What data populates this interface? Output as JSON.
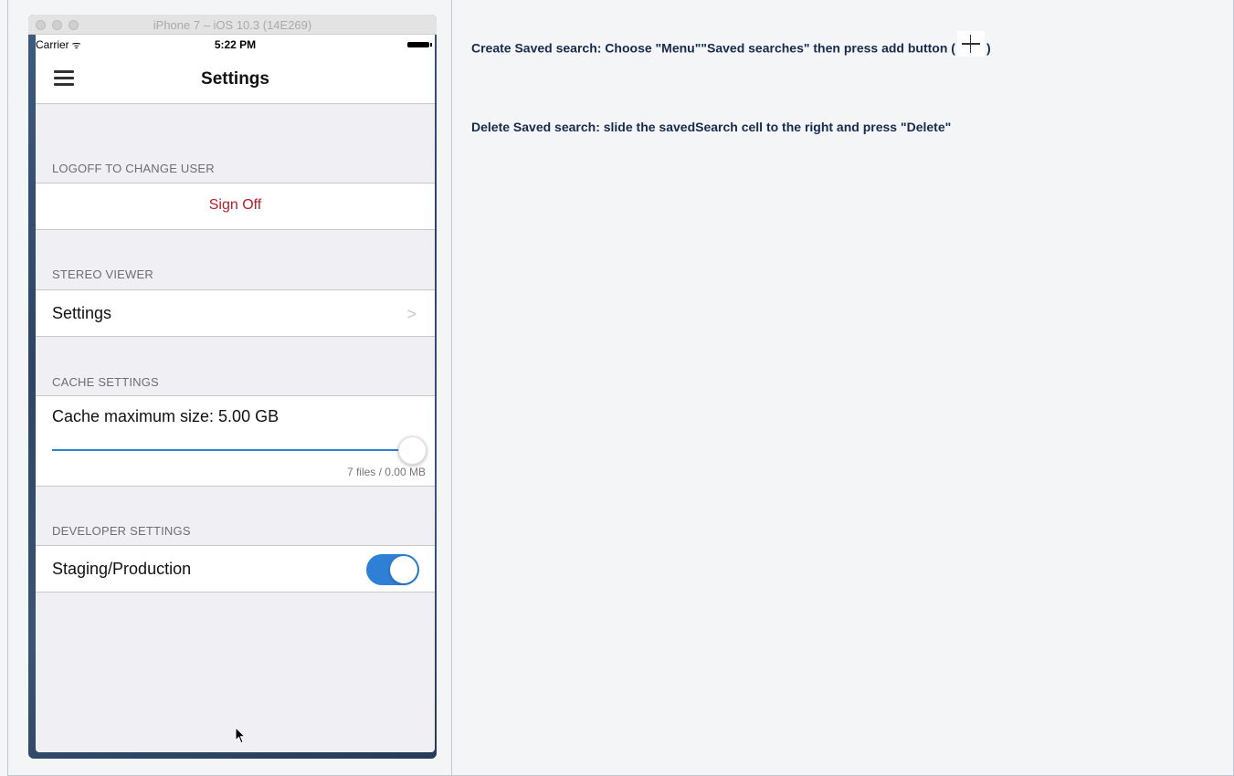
{
  "simulator": {
    "title": "iPhone 7 – iOS 10.3 (14E269)"
  },
  "statusbar": {
    "carrier": "Carrier",
    "time": "5:22 PM"
  },
  "navbar": {
    "title": "Settings"
  },
  "sections": {
    "logoff": {
      "header": "LOGOFF TO CHANGE USER",
      "signoff_label": "Sign Off"
    },
    "stereo": {
      "header": "STEREO VIEWER",
      "settings_label": "Settings",
      "chevron": ">"
    },
    "cache": {
      "header": "CACHE SETTINGS",
      "max_size_label": "Cache maximum size: 5.00 GB",
      "slider_value": 1.0,
      "stats": "7 files / 0.00 MB"
    },
    "developer": {
      "header": "DEVELOPER SETTINGS",
      "staging_label": "Staging/Production",
      "toggle_on": true
    }
  },
  "instructions": {
    "create_prefix": "Create Saved search: Choose \"Menu\"\"Saved searches\" then press add button (",
    "create_suffix": ")",
    "delete_text": "Delete Saved search: slide the savedSearch cell to the right and press \"Delete\""
  },
  "colors": {
    "accent": "#2e7fd6",
    "destructive": "#b0202a",
    "text_dark": "#172b4d"
  }
}
